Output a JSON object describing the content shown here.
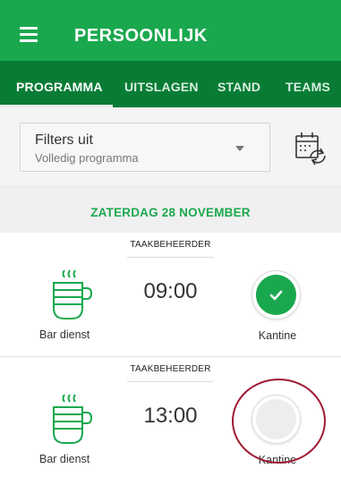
{
  "appbar": {
    "title": "PERSOONLIJK",
    "menu_icon": "hamburger-icon"
  },
  "tabs": [
    {
      "label": "PROGRAMMA",
      "active": true
    },
    {
      "label": "UITSLAGEN",
      "active": false
    },
    {
      "label": "STAND",
      "active": false
    },
    {
      "label": "TEAMS",
      "active": false
    }
  ],
  "filter": {
    "title": "Filters uit",
    "subtitle": "Volledig programma"
  },
  "date_header": "ZATERDAG 28 NOVEMBER",
  "duties": [
    {
      "role": "TAAKBEHEERDER",
      "duty": "Bar dienst",
      "time": "09:00",
      "location": "Kantine",
      "completed": true
    },
    {
      "role": "TAAKBEHEERDER",
      "duty": "Bar dienst",
      "time": "13:00",
      "location": "Kantine",
      "completed": false
    }
  ],
  "colors": {
    "primary": "#1aa84e",
    "tab_bar": "#087c35",
    "annotation": "#9e1b32"
  },
  "icons": {
    "duty": "coffee-cup-icon",
    "calendar": "calendar-refresh-icon",
    "check": "checkmark-icon",
    "dropdown": "chevron-down-icon"
  }
}
